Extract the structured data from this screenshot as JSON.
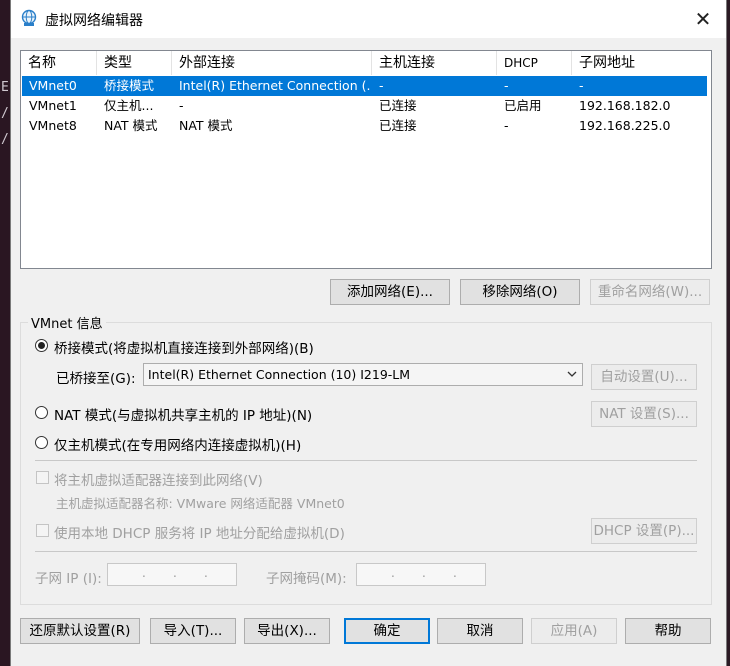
{
  "background": {
    "chars": [
      "E",
      "/",
      "/"
    ]
  },
  "window": {
    "title": "虚拟网络编辑器"
  },
  "table": {
    "headers": [
      "名称",
      "类型",
      "外部连接",
      "主机连接",
      "DHCP",
      "子网地址"
    ],
    "rows": [
      {
        "name": "VMnet0",
        "type": "桥接模式",
        "external": "Intel(R) Ethernet Connection (...",
        "host": "-",
        "dhcp": "-",
        "subnet": "-",
        "selected": true
      },
      {
        "name": "VMnet1",
        "type": "仅主机...",
        "external": "-",
        "host": "已连接",
        "dhcp": "已启用",
        "subnet": "192.168.182.0",
        "selected": false
      },
      {
        "name": "VMnet8",
        "type": "NAT 模式",
        "external": "NAT 模式",
        "host": "已连接",
        "dhcp": "-",
        "subnet": "192.168.225.0",
        "selected": false
      }
    ]
  },
  "list_buttons": {
    "add": "添加网络(E)...",
    "remove": "移除网络(O)",
    "rename": "重命名网络(W)..."
  },
  "vmnet_info": {
    "label": "VMnet 信息",
    "bridge_radio": "桥接模式(将虚拟机直接连接到外部网络)(B)",
    "bridged_to_label": "已桥接至(G):",
    "bridged_to_value": "Intel(R) Ethernet Connection (10) I219-LM",
    "auto_settings": "自动设置(U)...",
    "nat_radio": "NAT 模式(与虚拟机共享主机的 IP 地址)(N)",
    "nat_settings": "NAT 设置(S)...",
    "hostonly_radio": "仅主机模式(在专用网络内连接虚拟机)(H)",
    "connect_adapter": "将主机虚拟适配器连接到此网络(V)",
    "adapter_name": "主机虚拟适配器名称: VMware 网络适配器 VMnet0",
    "use_dhcp": "使用本地 DHCP 服务将 IP 地址分配给虚拟机(D)",
    "dhcp_settings": "DHCP 设置(P)...",
    "subnet_ip_label": "子网 IP (I):",
    "subnet_mask_label": "子网掩码(M):",
    "selected_mode": "bridge"
  },
  "footer": {
    "restore": "还原默认设置(R)",
    "import": "导入(T)...",
    "export": "导出(X)...",
    "ok": "确定",
    "cancel": "取消",
    "apply": "应用(A)",
    "help": "帮助"
  },
  "colors": {
    "selection": "#0078d7",
    "window_bg": "#f0f0f0",
    "disabled_text": "#a0a0a0"
  }
}
